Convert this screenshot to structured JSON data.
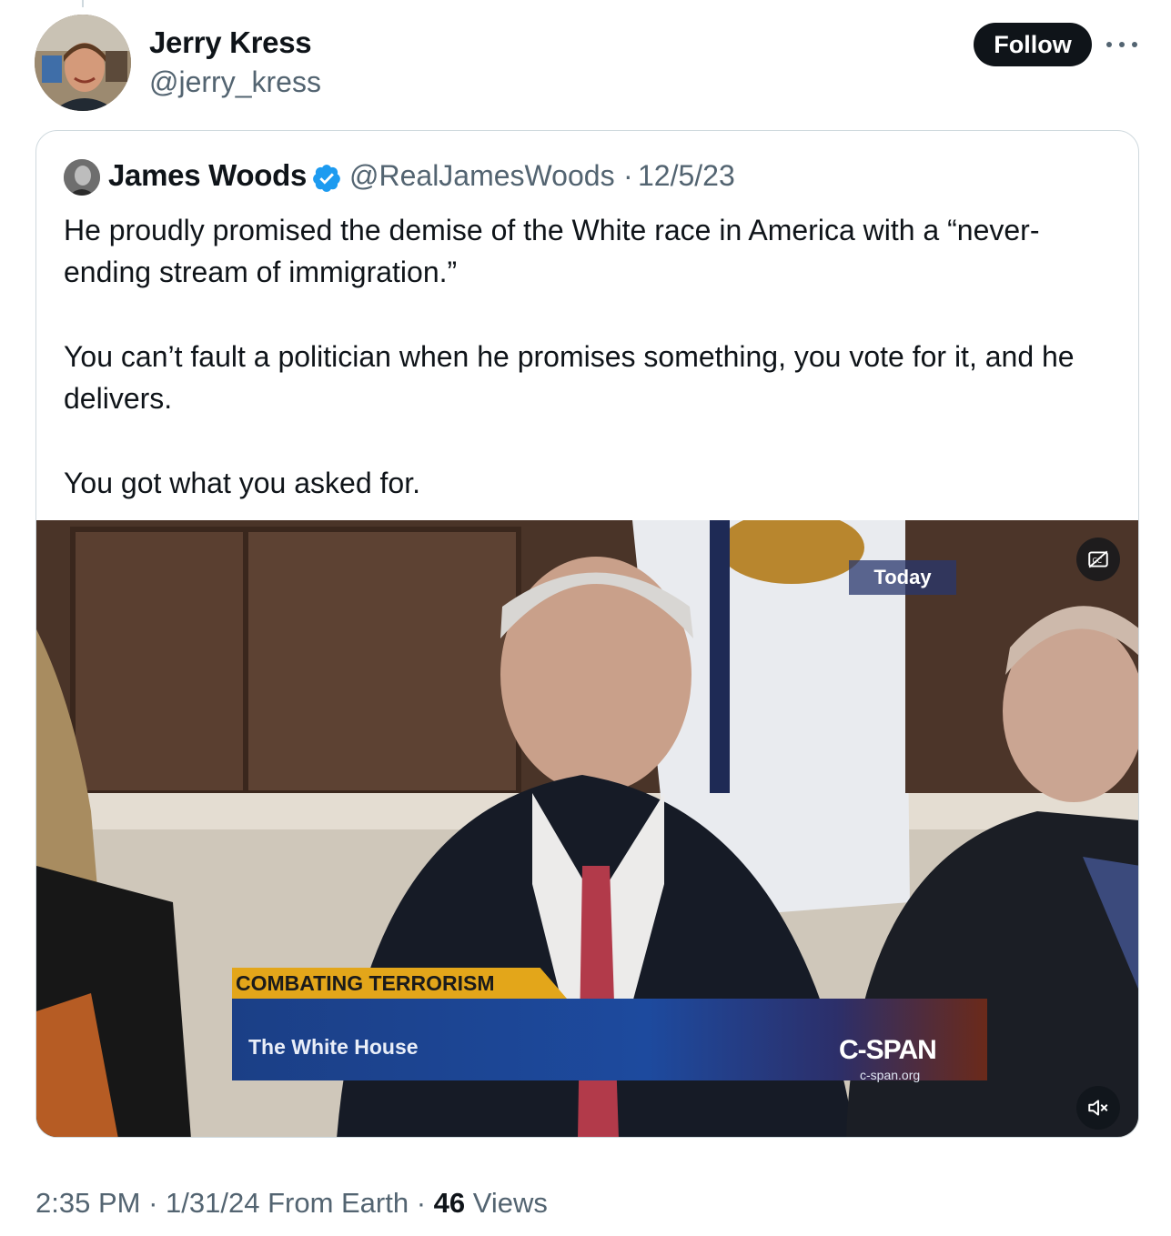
{
  "author": {
    "name": "Jerry Kress",
    "handle": "@jerry_kress",
    "avatar_icon": "profile-photo"
  },
  "actions": {
    "follow_label": "Follow",
    "more_icon": "ellipsis-icon"
  },
  "quoted": {
    "name": "James Woods",
    "verified": true,
    "verified_color": "#1d9bf0",
    "handle": "@RealJamesWoods",
    "separator": "·",
    "date": "12/5/23",
    "paragraphs": [
      "He proudly promised the demise of the White race in America with a “never-ending stream of immigration.”",
      "You can’t fault a politician when he promises something, you vote for it, and he delivers.",
      "You got what you asked for."
    ]
  },
  "video": {
    "overlay_corner": "Today",
    "lower_third_title": "COMBATING TERRORISM",
    "lower_third_subtitle": "The White House",
    "network": "C-SPAN",
    "network_url": "c-span.org",
    "cc_icon": "captions-off-icon",
    "mute_icon": "volume-muted-icon"
  },
  "footer": {
    "time": "2:35 PM",
    "sep1": " · ",
    "date": "1/31/24",
    "source": " From Earth",
    "sep2": " · ",
    "views_count": "46",
    "views_label": " Views"
  },
  "colors": {
    "text_primary": "#0f1419",
    "text_secondary": "#536471",
    "border": "#cfd9de",
    "follow_bg": "#0f1419",
    "follow_text": "#ffffff"
  }
}
